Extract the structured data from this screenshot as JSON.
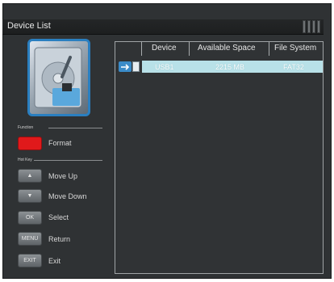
{
  "window": {
    "title": "Device List"
  },
  "sidebar": {
    "function_label": "Function",
    "function_items": [
      {
        "key": "",
        "label": "Format",
        "key_color": "#e0191b"
      }
    ],
    "hotkey_label": "Hot Key",
    "hotkeys": [
      {
        "key": "▲",
        "label": "Move Up",
        "icon": "arrow-up-icon"
      },
      {
        "key": "▼",
        "label": "Move Down",
        "icon": "arrow-down-icon"
      },
      {
        "key": "OK",
        "label": "Select"
      },
      {
        "key": "MENU",
        "label": "Return"
      },
      {
        "key": "EXIT",
        "label": "Exit"
      }
    ]
  },
  "table": {
    "columns": [
      "Device",
      "Available Space",
      "File System"
    ],
    "rows": [
      {
        "device": "USB1",
        "available_space": "2215 MB",
        "file_system": "FAT32",
        "icon": "usb-drive-icon"
      }
    ]
  },
  "colors": {
    "accent_blue": "#2a7fc0",
    "selection": "#b8e1e8",
    "function_key": "#e0191b"
  }
}
